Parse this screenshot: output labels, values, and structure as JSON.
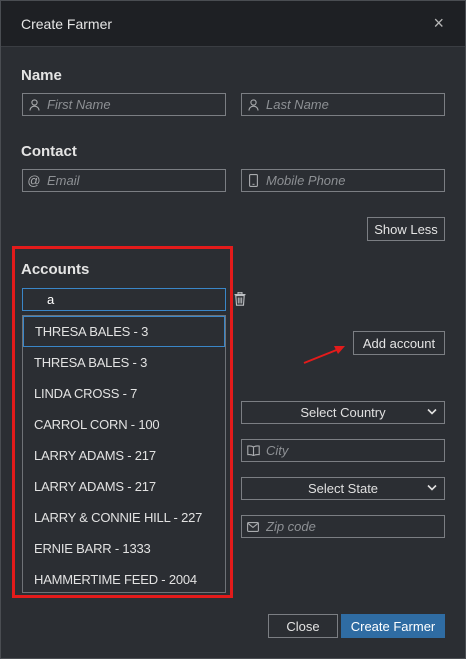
{
  "dialog": {
    "title": "Create Farmer",
    "close_glyph": "×"
  },
  "name_section": {
    "label": "Name",
    "first_name_placeholder": "First Name",
    "last_name_placeholder": "Last Name"
  },
  "contact_section": {
    "label": "Contact",
    "email_placeholder": "Email",
    "mobile_placeholder": "Mobile Phone",
    "show_less_label": "Show Less"
  },
  "accounts_section": {
    "label": "Accounts",
    "search_value": "a",
    "add_account_label": "Add account",
    "results": [
      "THRESA BALES - 3",
      "THRESA BALES - 3",
      "LINDA CROSS - 7",
      "CARROL CORN - 100",
      "LARRY ADAMS - 217",
      "LARRY ADAMS - 217",
      "LARRY & CONNIE HILL - 227",
      "ERNIE BARR - 1333",
      "HAMMERTIME FEED - 2004"
    ]
  },
  "address_section": {
    "country_selected": "Select Country",
    "city_placeholder": "City",
    "state_selected": "Select State",
    "zip_placeholder": "Zip code"
  },
  "footer": {
    "close_label": "Close",
    "create_label": "Create Farmer"
  },
  "colors": {
    "highlight": "#e31b1b",
    "primary": "#2f6ca3",
    "focus": "#3a86c8"
  }
}
